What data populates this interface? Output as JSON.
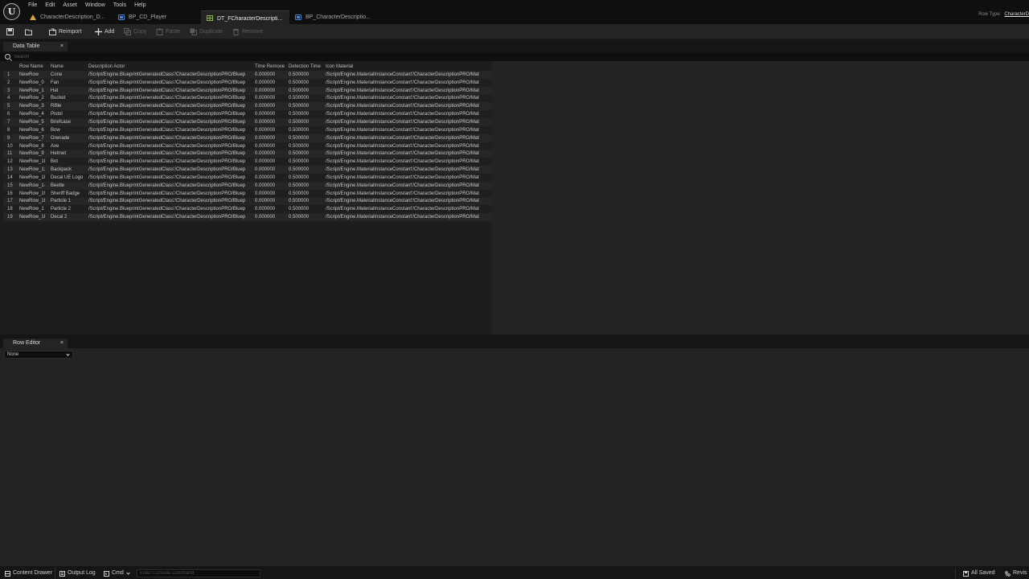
{
  "menu": [
    "File",
    "Edit",
    "Asset",
    "Window",
    "Tools",
    "Help"
  ],
  "tabs": [
    {
      "label": "CharacterDescription_D...",
      "icon": "data-asset-icon",
      "active": false
    },
    {
      "label": "BP_CD_Player",
      "icon": "blueprint-icon",
      "active": false
    },
    {
      "label": "DT_FCharacterDescripti...",
      "icon": "data-table-icon",
      "active": true
    },
    {
      "label": "BP_CharacterDescriptio...",
      "icon": "blueprint-icon",
      "active": false
    }
  ],
  "row_type": {
    "label": "Row Type:",
    "value": "CharacterD"
  },
  "toolbar": {
    "reimport": "Reimport",
    "add": "Add",
    "copy": "Copy",
    "paste": "Paste",
    "duplicate": "Duplicate",
    "remove": "Remove"
  },
  "data_table_tab": "Data Table",
  "search": {
    "placeholder": "Search"
  },
  "table": {
    "headers": [
      "",
      "Row Name",
      "Name",
      "Description Actor",
      "Time Remove",
      "Detection Time",
      "Icon Material"
    ],
    "rows": [
      [
        "1",
        "NewRow",
        "Cone",
        "/Script/Engine.BlueprintGeneratedClass'/CharacterDescriptionPRO/Bluep",
        "0.000000",
        "0.500000",
        "/Script/Engine.MaterialInstanceConstant'/CharacterDescriptionPRO/Mat"
      ],
      [
        "2",
        "NewRow_0",
        "Fan",
        "/Script/Engine.BlueprintGeneratedClass'/CharacterDescriptionPRO/Bluep",
        "0.000000",
        "0.500000",
        "/Script/Engine.MaterialInstanceConstant'/CharacterDescriptionPRO/Mat"
      ],
      [
        "3",
        "NewRow_1",
        "Hat",
        "/Script/Engine.BlueprintGeneratedClass'/CharacterDescriptionPRO/Bluep",
        "0.000000",
        "0.500000",
        "/Script/Engine.MaterialInstanceConstant'/CharacterDescriptionPRO/Mat"
      ],
      [
        "4",
        "NewRow_2",
        "Bucket",
        "/Script/Engine.BlueprintGeneratedClass'/CharacterDescriptionPRO/Bluep",
        "0.000000",
        "0.500000",
        "/Script/Engine.MaterialInstanceConstant'/CharacterDescriptionPRO/Mat"
      ],
      [
        "5",
        "NewRow_3",
        "Rifile",
        "/Script/Engine.BlueprintGeneratedClass'/CharacterDescriptionPRO/Bluep",
        "0.000000",
        "0.500000",
        "/Script/Engine.MaterialInstanceConstant'/CharacterDescriptionPRO/Mat"
      ],
      [
        "6",
        "NewRow_4",
        "Pistol",
        "/Script/Engine.BlueprintGeneratedClass'/CharacterDescriptionPRO/Bluep",
        "0.000000",
        "0.500000",
        "/Script/Engine.MaterialInstanceConstant'/CharacterDescriptionPRO/Mat"
      ],
      [
        "7",
        "NewRow_5",
        "Briefcase",
        "/Script/Engine.BlueprintGeneratedClass'/CharacterDescriptionPRO/Bluep",
        "0.000000",
        "0.500000",
        "/Script/Engine.MaterialInstanceConstant'/CharacterDescriptionPRO/Mat"
      ],
      [
        "8",
        "NewRow_6",
        "Bow",
        "/Script/Engine.BlueprintGeneratedClass'/CharacterDescriptionPRO/Bluep",
        "0.000000",
        "0.500000",
        "/Script/Engine.MaterialInstanceConstant'/CharacterDescriptionPRO/Mat"
      ],
      [
        "9",
        "NewRow_7",
        "Grenade",
        "/Script/Engine.BlueprintGeneratedClass'/CharacterDescriptionPRO/Bluep",
        "0.000000",
        "0.500000",
        "/Script/Engine.MaterialInstanceConstant'/CharacterDescriptionPRO/Mat"
      ],
      [
        "10",
        "NewRow_8",
        "Axe",
        "/Script/Engine.BlueprintGeneratedClass'/CharacterDescriptionPRO/Bluep",
        "0.000000",
        "0.500000",
        "/Script/Engine.MaterialInstanceConstant'/CharacterDescriptionPRO/Mat"
      ],
      [
        "11",
        "NewRow_9",
        "Helmet",
        "/Script/Engine.BlueprintGeneratedClass'/CharacterDescriptionPRO/Bluep",
        "0.000000",
        "0.500000",
        "/Script/Engine.MaterialInstanceConstant'/CharacterDescriptionPRO/Mat"
      ],
      [
        "12",
        "NewRow_1I",
        "Bot",
        "/Script/Engine.BlueprintGeneratedClass'/CharacterDescriptionPRO/Bluep",
        "0.000000",
        "0.500000",
        "/Script/Engine.MaterialInstanceConstant'/CharacterDescriptionPRO/Mat"
      ],
      [
        "13",
        "NewRow_1;",
        "Backpack",
        "/Script/Engine.BlueprintGeneratedClass'/CharacterDescriptionPRO/Bluep",
        "0.000000",
        "0.500000",
        "/Script/Engine.MaterialInstanceConstant'/CharacterDescriptionPRO/Mat"
      ],
      [
        "14",
        "NewRow_1I",
        "Decal UE Logo",
        "/Script/Engine.BlueprintGeneratedClass'/CharacterDescriptionPRO/Bluep",
        "0.000000",
        "0.500000",
        "/Script/Engine.MaterialInstanceConstant'/CharacterDescriptionPRO/Mat"
      ],
      [
        "15",
        "NewRow_1·",
        "Beetle",
        "/Script/Engine.BlueprintGeneratedClass'/CharacterDescriptionPRO/Bluep",
        "0.000000",
        "0.500000",
        "/Script/Engine.MaterialInstanceConstant'/CharacterDescriptionPRO/Mat"
      ],
      [
        "16",
        "NewRow_1!",
        "Sheriff Badge",
        "/Script/Engine.BlueprintGeneratedClass'/CharacterDescriptionPRO/Bluep",
        "0.000000",
        "0.500000",
        "/Script/Engine.MaterialInstanceConstant'/CharacterDescriptionPRO/Mat"
      ],
      [
        "17",
        "NewRow_1I",
        "Particle 1",
        "/Script/Engine.BlueprintGeneratedClass'/CharacterDescriptionPRO/Bluep",
        "0.000000",
        "0.500000",
        "/Script/Engine.MaterialInstanceConstant'/CharacterDescriptionPRO/Mat"
      ],
      [
        "18",
        "NewRow_1",
        "Particle 2",
        "/Script/Engine.BlueprintGeneratedClass'/CharacterDescriptionPRO/Bluep",
        "0.000000",
        "0.500000",
        "/Script/Engine.MaterialInstanceConstant'/CharacterDescriptionPRO/Mat"
      ],
      [
        "19",
        "NewRow_1I",
        "Decal 2",
        "/Script/Engine.BlueprintGeneratedClass'/CharacterDescriptionPRO/Bluep",
        "0.000000",
        "0.500000",
        "/Script/Engine.MaterialInstanceConstant'/CharacterDescriptionPRO/Mat"
      ]
    ]
  },
  "row_editor": {
    "tab": "Row Editor",
    "selected": "None"
  },
  "statusbar": {
    "content_drawer": "Content Drawer",
    "output_log": "Output Log",
    "cmd": "Cmd",
    "console_placeholder": "Enter Console Command",
    "all_saved": "All Saved",
    "revision": "Revis"
  },
  "colors": {
    "accent_orange": "#d9a14a",
    "blueprint_blue": "#4f87d8",
    "data_table_green": "#8ab34a"
  }
}
